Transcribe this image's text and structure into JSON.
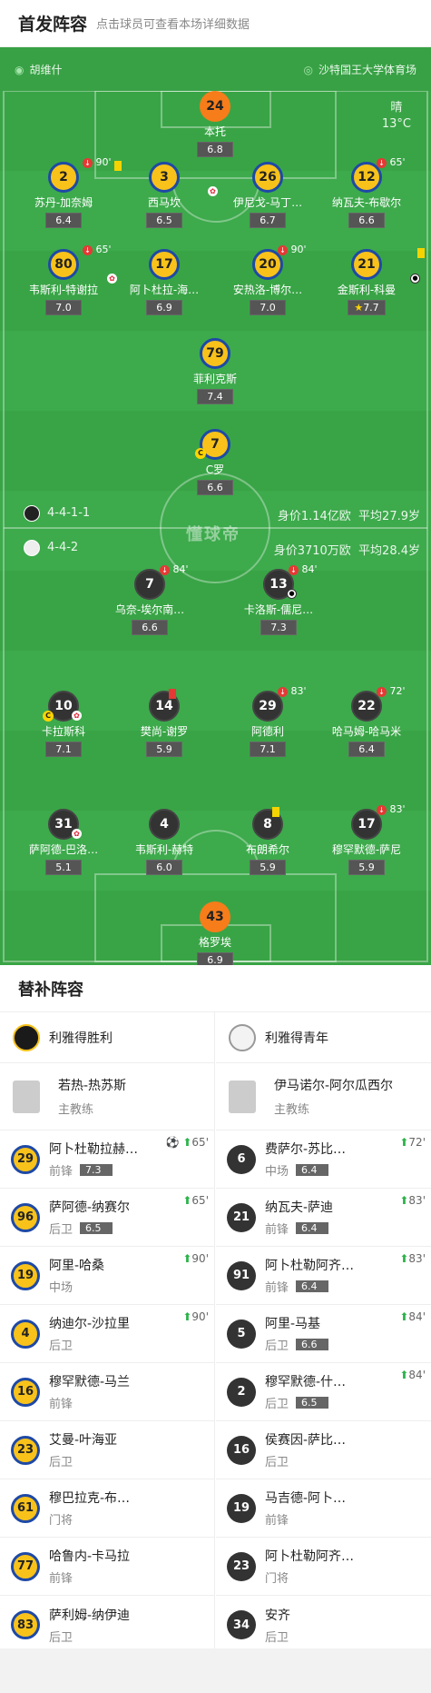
{
  "header": {
    "title": "首发阵容",
    "subtitle": "点击球员可查看本场详细数据"
  },
  "match_info": {
    "referee": "胡维什",
    "stadium": "沙特国王大学体育场",
    "weather": "晴",
    "temp": "13°C"
  },
  "home": {
    "formation": "4-4-1-1",
    "value": "身价1.14亿欧",
    "avg_age": "平均27.9岁",
    "players": [
      {
        "num": "24",
        "name": "本托",
        "rating": "6.8"
      },
      {
        "num": "2",
        "name": "苏丹-加奈姆",
        "rating": "6.4",
        "sub": "90'"
      },
      {
        "num": "3",
        "name": "西马坎",
        "rating": "6.5"
      },
      {
        "num": "26",
        "name": "伊尼戈-马丁…",
        "rating": "6.7"
      },
      {
        "num": "12",
        "name": "纳瓦夫-布歇尔",
        "rating": "6.6",
        "sub": "65'"
      },
      {
        "num": "80",
        "name": "韦斯利-特谢拉",
        "rating": "7.0",
        "sub": "65'"
      },
      {
        "num": "17",
        "name": "阿卜杜拉-海…",
        "rating": "6.9"
      },
      {
        "num": "20",
        "name": "安热洛-博尔…",
        "rating": "7.0",
        "sub": "90'"
      },
      {
        "num": "21",
        "name": "金斯利-科曼",
        "rating": "7.7"
      },
      {
        "num": "79",
        "name": "菲利克斯",
        "rating": "7.4"
      },
      {
        "num": "7",
        "name": "C罗",
        "rating": "6.6"
      }
    ]
  },
  "away": {
    "formation": "4-4-2",
    "value": "身价3710万欧",
    "avg_age": "平均28.4岁",
    "players": [
      {
        "num": "7",
        "name": "乌奈-埃尔南…",
        "rating": "6.6",
        "sub": "84'"
      },
      {
        "num": "13",
        "name": "卡洛斯-儒尼…",
        "rating": "7.3",
        "sub": "84'"
      },
      {
        "num": "10",
        "name": "卡拉斯科",
        "rating": "7.1"
      },
      {
        "num": "14",
        "name": "樊尚-谢罗",
        "rating": "5.9"
      },
      {
        "num": "29",
        "name": "阿德利",
        "rating": "7.1",
        "sub": "83'"
      },
      {
        "num": "22",
        "name": "哈马姆-哈马米",
        "rating": "6.4",
        "sub": "72'"
      },
      {
        "num": "31",
        "name": "萨阿德-巴洛…",
        "rating": "5.1"
      },
      {
        "num": "4",
        "name": "韦斯利-赫特",
        "rating": "6.0"
      },
      {
        "num": "8",
        "name": "布朗希尔",
        "rating": "5.9"
      },
      {
        "num": "17",
        "name": "穆罕默德-萨尼",
        "rating": "5.9",
        "sub": "83'"
      },
      {
        "num": "43",
        "name": "格罗埃",
        "rating": "6.9"
      }
    ]
  },
  "watermark": "懂球帝",
  "subs": {
    "title": "替补阵容",
    "home": {
      "team": "利雅得胜利",
      "coach": {
        "name": "若热-热苏斯",
        "role": "主教练"
      },
      "list": [
        {
          "num": "29",
          "name": "阿卜杜勒拉赫…",
          "pos": "前锋",
          "rating": "7.3",
          "in": "65'"
        },
        {
          "num": "96",
          "name": "萨阿德-纳赛尔",
          "pos": "后卫",
          "rating": "6.5",
          "in": "65'"
        },
        {
          "num": "19",
          "name": "阿里-哈桑",
          "pos": "中场",
          "in": "90'"
        },
        {
          "num": "4",
          "name": "纳迪尔-沙拉里",
          "pos": "后卫",
          "in": "90'"
        },
        {
          "num": "16",
          "name": "穆罕默德-马兰",
          "pos": "前锋"
        },
        {
          "num": "23",
          "name": "艾曼-叶海亚",
          "pos": "后卫"
        },
        {
          "num": "61",
          "name": "穆巴拉克-布…",
          "pos": "门将"
        },
        {
          "num": "77",
          "name": "哈鲁内-卡马拉",
          "pos": "前锋"
        },
        {
          "num": "83",
          "name": "萨利姆-纳伊迪",
          "pos": "后卫"
        }
      ]
    },
    "away": {
      "team": "利雅得青年",
      "coach": {
        "name": "伊马诺尔-阿尔瓜西尔",
        "role": "主教练"
      },
      "list": [
        {
          "num": "6",
          "name": "费萨尔-苏比…",
          "pos": "中场",
          "rating": "6.4",
          "in": "72'"
        },
        {
          "num": "21",
          "name": "纳瓦夫-萨迪",
          "pos": "前锋",
          "rating": "6.4",
          "in": "83'"
        },
        {
          "num": "91",
          "name": "阿卜杜勒阿齐…",
          "pos": "前锋",
          "rating": "6.4",
          "in": "83'"
        },
        {
          "num": "5",
          "name": "阿里-马基",
          "pos": "后卫",
          "rating": "6.6",
          "in": "84'"
        },
        {
          "num": "2",
          "name": "穆罕默德-什…",
          "pos": "后卫",
          "rating": "6.5",
          "in": "84'"
        },
        {
          "num": "16",
          "name": "侯赛因-萨比…",
          "pos": "后卫"
        },
        {
          "num": "19",
          "name": "马吉德-阿卜…",
          "pos": "前锋"
        },
        {
          "num": "23",
          "name": "阿卜杜勒阿齐…",
          "pos": "门将"
        },
        {
          "num": "34",
          "name": "安齐",
          "pos": "后卫"
        }
      ]
    }
  }
}
